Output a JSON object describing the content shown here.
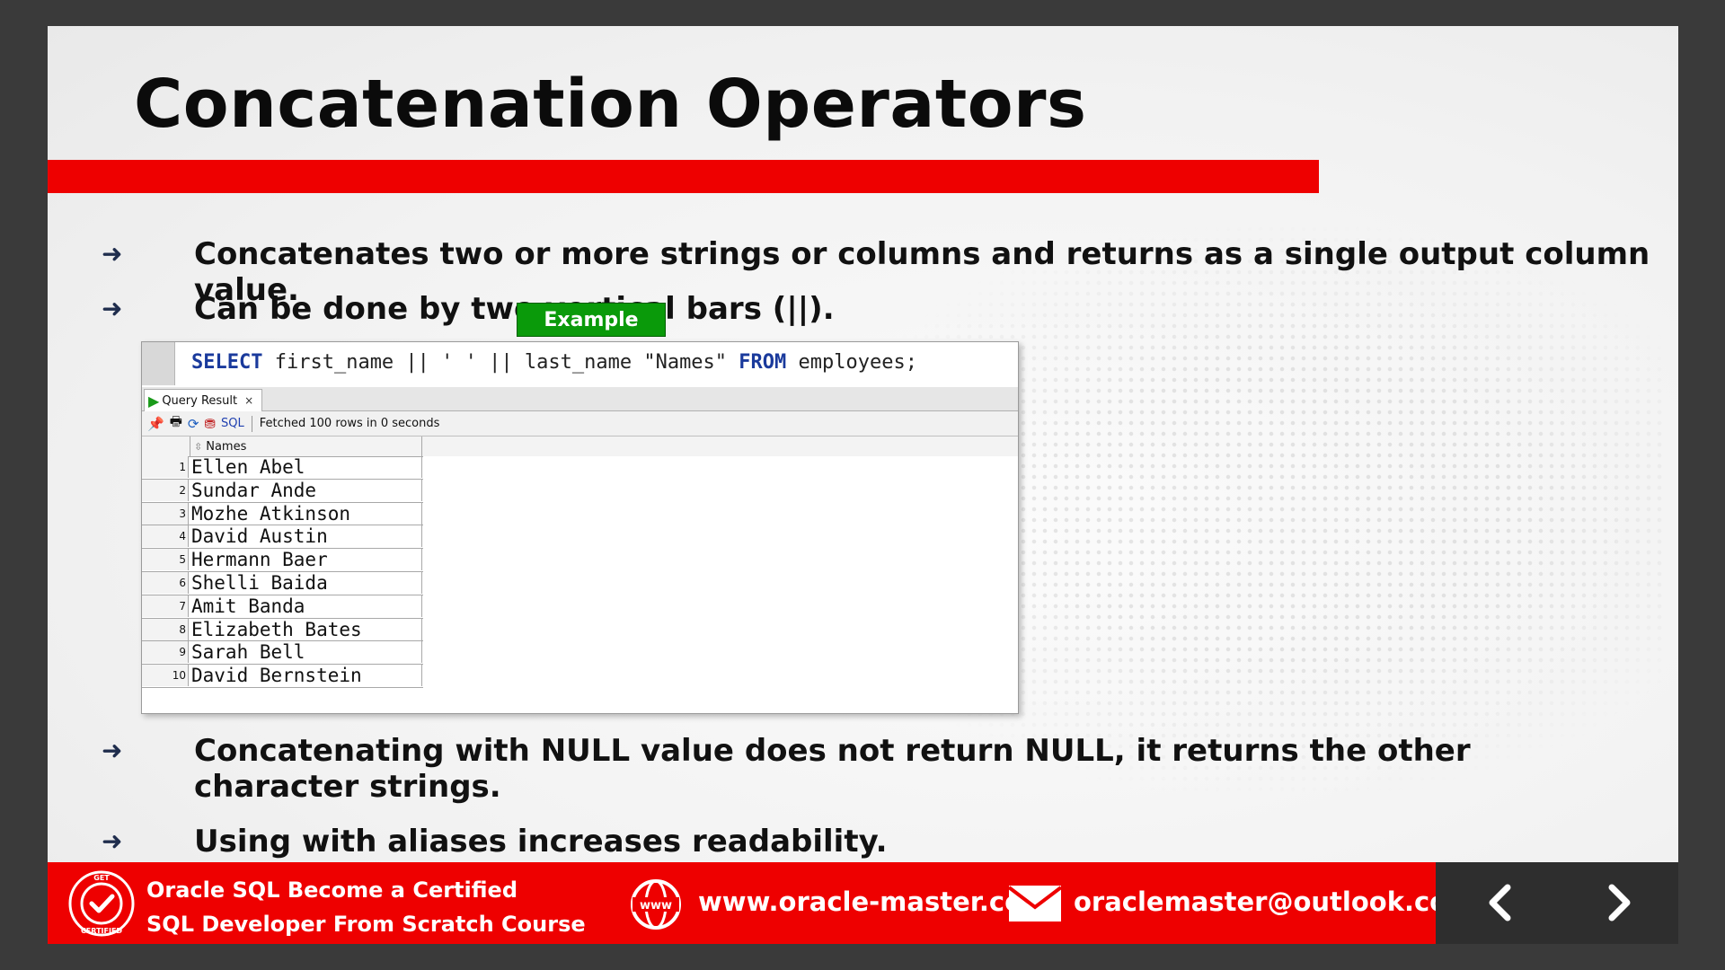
{
  "slide": {
    "title": "Concatenation Operators",
    "bullets": [
      "Concatenates two or more strings or columns and returns as a single output column value.",
      "Can be done by two vertical bars (||).",
      "Concatenating with NULL value does not return NULL, it returns the other character strings.",
      "Using with aliases increases readability."
    ],
    "example_label": "Example"
  },
  "sql_window": {
    "code": {
      "kw_select": "SELECT",
      "expr": " first_name || ' ' || last_name \"Names\" ",
      "kw_from": "FROM",
      "table": " employees;"
    },
    "tab_label": "Query Result",
    "toolbar_sql": "SQL",
    "status": "Fetched 100 rows in 0 seconds",
    "column_header": "Names",
    "rows": [
      {
        "n": "1",
        "name": "Ellen Abel"
      },
      {
        "n": "2",
        "name": "Sundar Ande"
      },
      {
        "n": "3",
        "name": "Mozhe Atkinson"
      },
      {
        "n": "4",
        "name": "David Austin"
      },
      {
        "n": "5",
        "name": "Hermann Baer"
      },
      {
        "n": "6",
        "name": "Shelli Baida"
      },
      {
        "n": "7",
        "name": "Amit Banda"
      },
      {
        "n": "8",
        "name": "Elizabeth Bates"
      },
      {
        "n": "9",
        "name": "Sarah Bell"
      },
      {
        "n": "10",
        "name": "David Bernstein"
      }
    ]
  },
  "footer": {
    "course_line1": "Oracle SQL Become a Certified",
    "course_line2": "SQL  Developer  From Scratch Course",
    "website": "www.oracle-master.com",
    "email": "oraclemaster@outlook.com",
    "logo_text_top": "GET",
    "logo_text_bottom": "CERTIFIED",
    "www_icon_text": "www"
  },
  "colors": {
    "accent_red": "#ee0000",
    "example_green": "#0a9a0a",
    "sql_keyword": "#1a3a9c"
  }
}
